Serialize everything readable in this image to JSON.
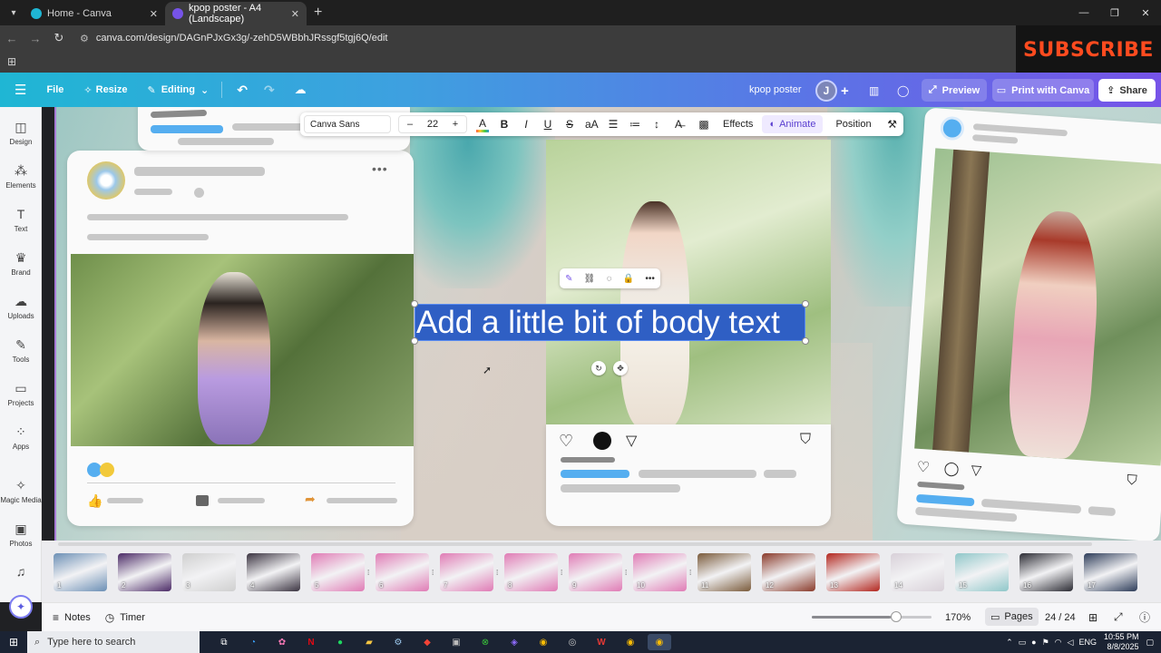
{
  "browser": {
    "tabs": [
      {
        "title": "Home - Canva",
        "active": false,
        "close": "✕"
      },
      {
        "title": "kpop poster - A4 (Landscape)",
        "active": true,
        "close": "✕"
      }
    ],
    "new_tab": "+",
    "url": "canva.com/design/DAGnPJxGx3g/-zehD5WBbhJRssgf5tgj6Q/edit",
    "window": {
      "minimize": "—",
      "restore": "❐",
      "close": "✕"
    }
  },
  "overlay": {
    "subscribe_text": "SUBSCRIBE"
  },
  "canva_header": {
    "file": "File",
    "resize": "Resize",
    "editing": "Editing",
    "doc_title": "kpop poster",
    "avatar_initial": "J",
    "preview": "Preview",
    "print": "Print with Canva",
    "share": "Share"
  },
  "left_rail": [
    {
      "label": "Design",
      "icon": "design-icon",
      "glyph": "◫"
    },
    {
      "label": "Elements",
      "icon": "elements-icon",
      "glyph": "⁂"
    },
    {
      "label": "Text",
      "icon": "text-icon",
      "glyph": "T"
    },
    {
      "label": "Brand",
      "icon": "brand-icon",
      "glyph": "♛"
    },
    {
      "label": "Uploads",
      "icon": "uploads-icon",
      "glyph": "☁"
    },
    {
      "label": "Tools",
      "icon": "tools-icon",
      "glyph": "✎"
    },
    {
      "label": "Projects",
      "icon": "projects-icon",
      "glyph": "▭"
    },
    {
      "label": "Apps",
      "icon": "apps-icon",
      "glyph": "⁘"
    },
    {
      "label": "Magic Media",
      "icon": "magic-media-icon",
      "glyph": "✧"
    },
    {
      "label": "Photos",
      "icon": "photos-icon",
      "glyph": "▣"
    },
    {
      "label": "",
      "icon": "audio-icon",
      "glyph": "♫"
    }
  ],
  "text_toolbar": {
    "font": "Canva Sans",
    "minus": "–",
    "size": "22",
    "plus": "+",
    "case": "aA",
    "effects": "Effects",
    "animate": "Animate",
    "position": "Position"
  },
  "canvas": {
    "selected_text": "Add a little bit of body text"
  },
  "pages": {
    "thumbnails": [
      {
        "num": "1",
        "color": "#6b8fb5"
      },
      {
        "num": "2",
        "color": "#4b2a66"
      },
      {
        "num": "3",
        "color": "#cfcfcf"
      },
      {
        "num": "4",
        "color": "#3a3340"
      },
      {
        "num": "5",
        "color": "#e07bb5"
      },
      {
        "num": "6",
        "color": "#e07bb5"
      },
      {
        "num": "7",
        "color": "#e07bb5"
      },
      {
        "num": "8",
        "color": "#e07bb5"
      },
      {
        "num": "9",
        "color": "#e07bb5"
      },
      {
        "num": "10",
        "color": "#e07bb5"
      },
      {
        "num": "11",
        "color": "#7a5a3a"
      },
      {
        "num": "12",
        "color": "#8a3a2a"
      },
      {
        "num": "13",
        "color": "#b3261e"
      },
      {
        "num": "14",
        "color": "#d8d0d8"
      },
      {
        "num": "15",
        "color": "#8fc7c9"
      },
      {
        "num": "16",
        "color": "#2b2b33"
      },
      {
        "num": "17",
        "color": "#2c3b58"
      }
    ]
  },
  "bottom_bar": {
    "notes": "Notes",
    "timer": "Timer",
    "zoom": "170%",
    "zoom_level": 0.66,
    "pages": "Pages",
    "page_count": "24 / 24"
  },
  "taskbar": {
    "search_placeholder": "Type here to search",
    "language": "ENG",
    "time": "10:55 PM",
    "date": "8/8/2025"
  },
  "colors": {
    "accent_purple": "#7653e8",
    "accent_teal": "#1fb6d4",
    "selection_blue": "#2f5fc4",
    "subscribe_red": "#ff4b1f"
  }
}
